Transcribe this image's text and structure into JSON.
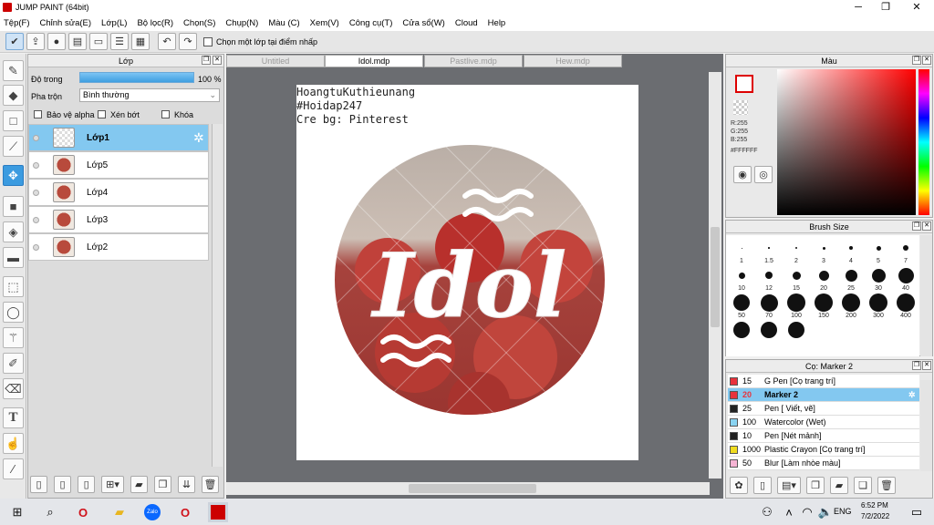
{
  "window": {
    "title": "JUMP PAINT (64bit)",
    "minimize": "─",
    "maximize": "❐",
    "close": "✕"
  },
  "menu": [
    "Tệp(F)",
    "Chỉnh sửa(E)",
    "Lớp(L)",
    "Bộ lọc(R)",
    "Chọn(S)",
    "Chụp(N)",
    "Màu (C)",
    "Xem(V)",
    "Công cụ(T)",
    "Cửa sổ(W)",
    "Cloud",
    "Help"
  ],
  "toolbar": {
    "checkbox_label": "Chọn một lớp tại điểm nhấp"
  },
  "layer_panel": {
    "title": "Lớp",
    "opacity_label": "Độ trong",
    "opacity_value": "100 %",
    "opacity": 1.0,
    "blend_label": "Pha trộn",
    "blend_value": "Bình thường",
    "lock_alpha": "Bảo vệ alpha",
    "clip": "Xén bớt",
    "lock": "Khóa",
    "layers": [
      {
        "name": "Lớp1",
        "selected": true
      },
      {
        "name": "Lớp5",
        "selected": false
      },
      {
        "name": "Lớp4",
        "selected": false
      },
      {
        "name": "Lớp3",
        "selected": false
      },
      {
        "name": "Lớp2",
        "selected": false
      }
    ]
  },
  "tabs": [
    {
      "label": "Untitled",
      "active": false
    },
    {
      "label": "Idol.mdp",
      "active": true
    },
    {
      "label": "Pastlive.mdp",
      "active": false
    },
    {
      "label": "Hew.mdp",
      "active": false
    }
  ],
  "canvas": {
    "lines": [
      "HoangtuKuthieunang",
      "#Hoidap247",
      "Cre bg: Pinterest"
    ],
    "art_word": "Idol"
  },
  "color_panel": {
    "title": "Màu",
    "r": "R:255",
    "g": "G:255",
    "b": "B:255",
    "hex": "#FFFFFF",
    "fg_color": "#ffffff",
    "bg_color": "#ffffff"
  },
  "brush_panel": {
    "title": "Brush Size",
    "sizes": [
      "1",
      "1.5",
      "2",
      "3",
      "4",
      "5",
      "7",
      "10",
      "12",
      "15",
      "20",
      "25",
      "30",
      "40",
      "50",
      "70",
      "100",
      "150",
      "200",
      "300",
      "400",
      "",
      "",
      ""
    ]
  },
  "pen_panel": {
    "title": "Cọ: Marker 2",
    "items": [
      {
        "size": "15",
        "name": "G Pen [Cọ trang trí]",
        "color": "#e8323c",
        "selected": false
      },
      {
        "size": "20",
        "name": "Marker 2",
        "color": "#e8323c",
        "selected": true
      },
      {
        "size": "25",
        "name": "Pen [ Viết, vẽ]",
        "color": "#222222",
        "selected": false
      },
      {
        "size": "100",
        "name": "Watercolor (Wet)",
        "color": "#8ad4f2",
        "selected": false
      },
      {
        "size": "10",
        "name": "Pen [Nét mảnh]",
        "color": "#222222",
        "selected": false
      },
      {
        "size": "1000",
        "name": "Plastic Crayon [Cọ trang trí]",
        "color": "#f0dc1e",
        "selected": false
      },
      {
        "size": "50",
        "name": "Blur [Làm nhòe màu]",
        "color": "#f6b4d4",
        "selected": false
      }
    ]
  },
  "taskbar": {
    "time": "6:52 PM",
    "date": "7/2/2022",
    "lang": "ENG"
  }
}
